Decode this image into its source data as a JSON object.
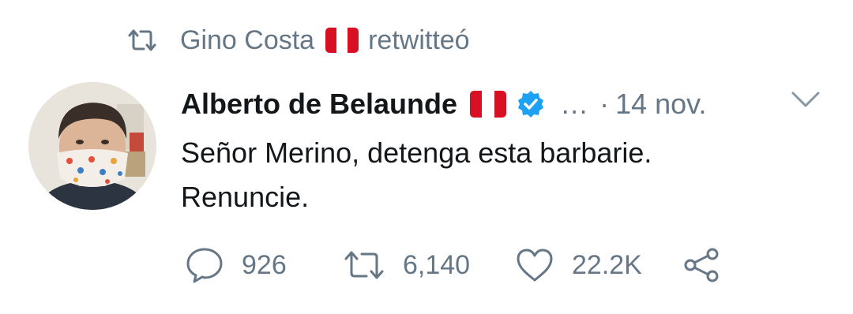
{
  "retweet_context": {
    "user": "Gino Costa",
    "action": "retwitteó"
  },
  "tweet": {
    "author_name": "Alberto de Belaunde",
    "ellipsis": "…",
    "separator": "·",
    "date": "14 nov.",
    "text_lines": [
      "Señor Merino, detenga esta barbarie.",
      "Renuncie."
    ],
    "reply_count": "926",
    "retweet_count": "6,140",
    "like_count": "22.2K"
  },
  "icons": {
    "retweet": "retweet-icon",
    "flag": "peru-flag-icon",
    "verified": "verified-badge-icon",
    "more": "chevron-down-icon",
    "reply": "reply-icon",
    "like": "like-icon",
    "share": "share-icon"
  },
  "colors": {
    "text_primary": "#14171a",
    "text_secondary": "#657786",
    "verified_blue": "#1da1f2",
    "flag_red": "#d91023"
  }
}
